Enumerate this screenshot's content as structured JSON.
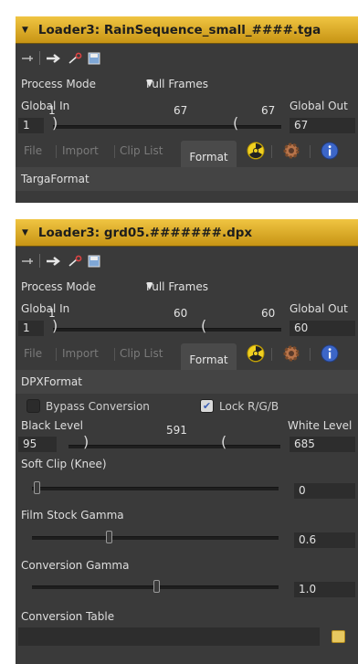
{
  "panels": [
    {
      "title": "Loader3: RainSequence_small_####.tga",
      "process_mode_label": "Process Mode",
      "process_mode_value": "Full Frames",
      "global_in_label": "Global In",
      "global_out_label": "Global Out",
      "range_start": "1",
      "range_mid": "67",
      "range_end": "67",
      "global_in_value": "1",
      "global_out_value": "67",
      "tabs": [
        "File",
        "Import",
        "Clip List",
        "Format"
      ],
      "active_tab": "Format",
      "format_name": "TargaFormat"
    },
    {
      "title": "Loader3: grd05.#######.dpx",
      "process_mode_label": "Process Mode",
      "process_mode_value": "Full Frames",
      "global_in_label": "Global In",
      "global_out_label": "Global Out",
      "range_start": "1",
      "range_mid": "60",
      "range_end": "60",
      "global_in_value": "1",
      "global_out_value": "60",
      "tabs": [
        "File",
        "Import",
        "Clip List",
        "Format"
      ],
      "active_tab": "Format",
      "format_name": "DPXFormat",
      "bypass_conversion_label": "Bypass Conversion",
      "bypass_conversion_checked": false,
      "lock_rgb_label": "Lock R/G/B",
      "lock_rgb_checked": true,
      "black_level_label": "Black Level",
      "white_level_label": "White Level",
      "level_mid": "591",
      "black_level_value": "95",
      "white_level_value": "685",
      "soft_clip_label": "Soft Clip (Knee)",
      "soft_clip_value": "0",
      "film_stock_gamma_label": "Film Stock Gamma",
      "film_stock_gamma_value": "0.6",
      "conversion_gamma_label": "Conversion Gamma",
      "conversion_gamma_value": "1.0",
      "conversion_table_label": "Conversion Table",
      "conversion_table_value": ""
    }
  ],
  "icons": [
    "collapse-arrow-icon",
    "pin-icon",
    "arrow-icon",
    "wand-icon",
    "save-icon",
    "radiation-icon",
    "gear-icon",
    "info-icon",
    "folder-icon",
    "dropdown-arrow-icon"
  ],
  "colors": {
    "header": "#e0ad2a",
    "panel": "#3a3a3a",
    "field": "#2d2d2d"
  }
}
